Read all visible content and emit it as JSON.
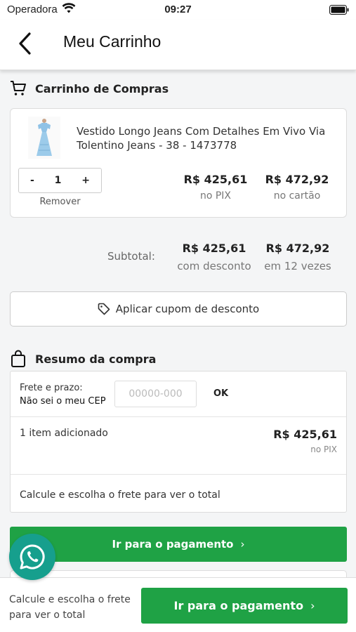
{
  "statusbar": {
    "carrier": "Operadora",
    "time": "09:27"
  },
  "header": {
    "title": "Meu Carrinho"
  },
  "cart": {
    "title": "Carrinho de Compras",
    "item": {
      "name": "Vestido Longo Jeans Com Detalhes Em Vivo Via Tolentino Jeans - 38 - 1473778",
      "quantity": "1",
      "minus": "-",
      "plus": "+",
      "remove_label": "Remover",
      "price_pix": "R$ 425,61",
      "price_pix_label": "no PIX",
      "price_card": "R$ 472,92",
      "price_card_label": "no cartão"
    },
    "subtotal": {
      "label": "Subtotal:",
      "discount_value": "R$ 425,61",
      "discount_label": "com desconto",
      "installment_value": "R$ 472,92",
      "installment_label": "em 12 vezes"
    },
    "coupon_label": "Aplicar cupom de desconto"
  },
  "summary": {
    "title": "Resumo da compra",
    "shipping_label": "Frete e prazo:",
    "unknown_cep_label": "Não sei o meu CEP",
    "cep_placeholder": "00000-000",
    "ok_label": "OK",
    "items_added": "1 item adicionado",
    "items_price": "R$ 425,61",
    "items_price_label": "no PIX",
    "calc_message": "Calcule e escolha o frete para ver o total"
  },
  "actions": {
    "pay_label": "Ir para o pagamento",
    "chevron": "›"
  },
  "bottom_bar": {
    "message": "Calcule e escolha o frete para ver o total",
    "pay_label": "Ir para o pagamento"
  },
  "colors": {
    "primary_green": "#1fa245",
    "whatsapp_teal": "#169f8d"
  },
  "icons": [
    "wifi-icon",
    "battery-icon",
    "back-arrow-icon",
    "cart-icon",
    "tag-icon",
    "shopping-bag-icon",
    "whatsapp-icon"
  ]
}
